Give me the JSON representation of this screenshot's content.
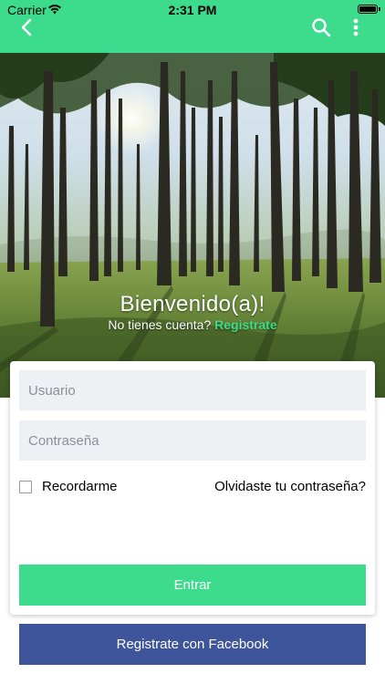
{
  "status_bar": {
    "carrier": "Carrier",
    "time": "2:31 PM"
  },
  "nav": {
    "back_icon": "chevron-left-icon",
    "search_icon": "search-icon",
    "more_icon": "more-vertical-icon",
    "bar_color": "#3ddc8c"
  },
  "hero": {
    "title": "Bienvenido(a)!",
    "question": "No tienes cuenta?",
    "register_link": "Registrate"
  },
  "login_form": {
    "username_placeholder": "Usuario",
    "password_placeholder": "Contraseña",
    "remember_label": "Recordarme",
    "remember_checked": false,
    "forgot_link": "Olvidaste tu contraseña?",
    "submit_label": "Entrar"
  },
  "facebook": {
    "label": "Registrate con Facebook",
    "color": "#3f559b"
  },
  "colors": {
    "accent": "#3ddc8c"
  }
}
